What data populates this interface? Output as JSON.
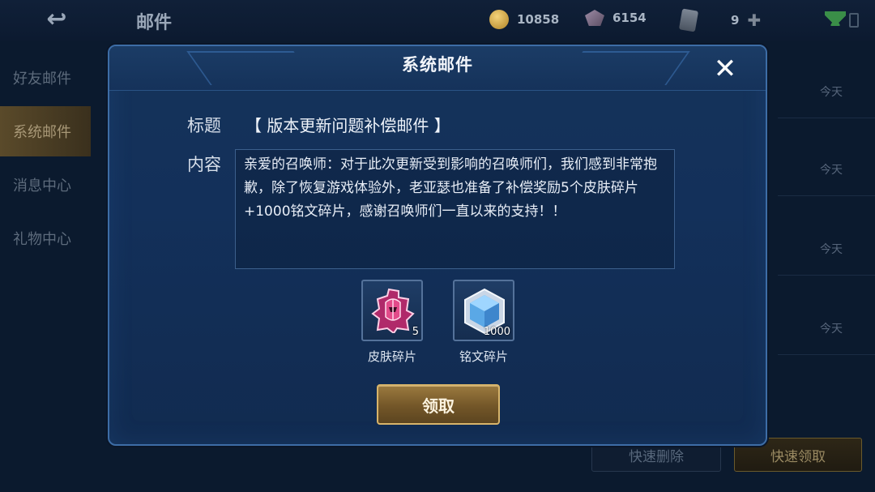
{
  "background": {
    "title": "邮件",
    "resources": {
      "gold": "10858",
      "diamonds": "6154",
      "tickets": "9"
    },
    "sidebar": [
      {
        "label": "好友邮件"
      },
      {
        "label": "系统邮件",
        "active": true
      },
      {
        "label": "消息中心"
      },
      {
        "label": "礼物中心"
      }
    ],
    "rows": [
      {
        "time": "今天"
      },
      {
        "time": "今天"
      },
      {
        "time": "今天"
      },
      {
        "time": "今天"
      }
    ],
    "quick_delete": "快速删除",
    "quick_claim": "快速领取"
  },
  "modal": {
    "title": "系统邮件",
    "subject_label": "标题",
    "subject": "【 版本更新问题补偿邮件 】",
    "content_label": "内容",
    "content": "亲爱的召唤师：对于此次更新受到影响的召唤师们，我们感到非常抱歉，除了恢复游戏体验外，老亚瑟也准备了补偿奖励5个皮肤碎片+1000铭文碎片，感谢召唤师们一直以来的支持！！",
    "rewards": [
      {
        "name": "皮肤碎片",
        "count": "5",
        "icon": "skin-shard-icon"
      },
      {
        "name": "铭文碎片",
        "count": "1000",
        "icon": "rune-shard-icon"
      }
    ],
    "claim_label": "领取"
  },
  "colors": {
    "gold_button": "#d7b46a",
    "panel_border": "#3d6da6",
    "panel_bg": "#15335a"
  }
}
